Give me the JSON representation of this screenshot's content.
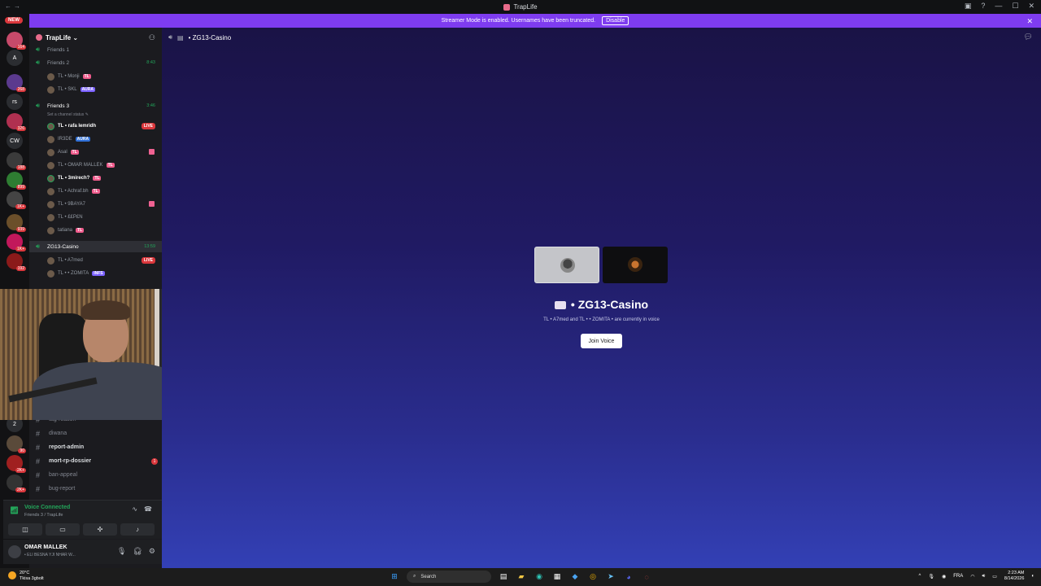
{
  "window": {
    "title": "TrapLife",
    "controls": [
      "—",
      "☐",
      "✕"
    ]
  },
  "banner": {
    "text": "Streamer Mode is enabled. Usernames have been truncated.",
    "button": "Disable"
  },
  "rail": {
    "new_label": "NEW",
    "servers": [
      {
        "label": "",
        "badge": "164"
      },
      {
        "label": "A",
        "badge": ""
      },
      {
        "label": "",
        "badge": "268"
      },
      {
        "label": "rs",
        "badge": ""
      },
      {
        "label": "",
        "badge": "326"
      },
      {
        "label": "CW",
        "badge": ""
      },
      {
        "label": "",
        "badge": "188"
      },
      {
        "label": "",
        "badge": "899"
      },
      {
        "label": "",
        "badge": "1K+"
      },
      {
        "label": "",
        "badge": "939"
      },
      {
        "label": "",
        "badge": "1K+"
      },
      {
        "label": "",
        "badge": "192"
      },
      {
        "label": "2",
        "badge": ""
      },
      {
        "label": "",
        "badge": "90"
      },
      {
        "label": "",
        "badge": "2K+"
      },
      {
        "label": "",
        "badge": "2K+"
      }
    ]
  },
  "sidebar": {
    "guild_name": "TrapLife ⌄",
    "channels": [
      {
        "name": "Friends 1",
        "time": ""
      },
      {
        "name": "Friends 2",
        "time": "8:43"
      },
      {
        "name": "Friends 3",
        "time": "3:46"
      },
      {
        "name": "ZG13-Casino",
        "time": "13:59"
      }
    ],
    "friends2_users": [
      {
        "name": "TL • Monji",
        "tag": "TL"
      },
      {
        "name": "TL • SKL",
        "tag": "AURA"
      }
    ],
    "friends3_status": "Set a channel status ✎",
    "friends3_users": [
      {
        "name": "TL • rafa lemridh",
        "tag": "",
        "live": "LIVE"
      },
      {
        "name": "IR3DE",
        "tag": "AURA",
        "live": ""
      },
      {
        "name": "Asal",
        "tag": "TL",
        "live": ""
      },
      {
        "name": "TL • OMAR MALLEK",
        "tag": "TL",
        "live": ""
      },
      {
        "name": "TL • 3mirech?",
        "tag": "TL",
        "live": ""
      },
      {
        "name": "TL • Achraf.bh",
        "tag": "TL",
        "live": ""
      },
      {
        "name": "TL • 9BAYA7",
        "tag": "",
        "live": ""
      },
      {
        "name": "TL • ££P£N",
        "tag": "",
        "live": ""
      },
      {
        "name": "tatiana",
        "tag": "TL",
        "live": ""
      }
    ],
    "casino_users": [
      {
        "name": "TL • A7med",
        "tag": "",
        "live": "LIVE"
      },
      {
        "name": "TL • • ZOMITA",
        "tag": "INFS",
        "live": ""
      }
    ],
    "text_channels": [
      {
        "name": "tag-reason",
        "bold": false,
        "unread": ""
      },
      {
        "name": "diwana",
        "bold": false,
        "unread": ""
      },
      {
        "name": "report-admin",
        "bold": true,
        "unread": ""
      },
      {
        "name": "mort-rp-dossier",
        "bold": true,
        "unread": "1"
      },
      {
        "name": "ban-appeal",
        "bold": false,
        "unread": ""
      },
      {
        "name": "bug-report",
        "bold": false,
        "unread": ""
      }
    ]
  },
  "voice_panel": {
    "title": "Voice Connected",
    "subtitle": "Friends 3 / TrapLife"
  },
  "user_panel": {
    "name": "OMAR MALLEK",
    "status": "• ELI BESNA YJI NHAR W..."
  },
  "main": {
    "channel_title": "• ZG13-Casino",
    "voice_name": "• ZG13-Casino",
    "voice_info": "TL • A7med and TL • • ZOMITA • are currently in voice",
    "join_label": "Join Voice"
  },
  "taskbar": {
    "weather_temp": "20°C",
    "weather_desc": "Tkisa 3gbolt",
    "search_placeholder": "Search",
    "lang": "FRA",
    "time": "2:23 AM",
    "date": "8/14/2026"
  },
  "colors": {
    "accent": "#7e3cf0",
    "live": "#da373c",
    "voice_green": "#23a55a",
    "tag_pink": "#f05b8c"
  }
}
